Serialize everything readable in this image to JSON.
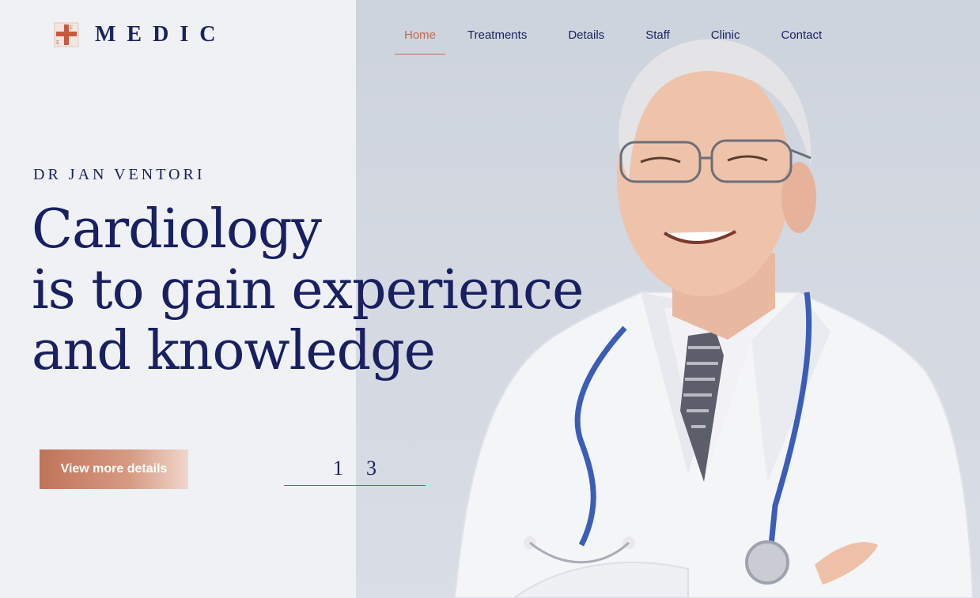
{
  "brand": {
    "name": "MEDIC",
    "logo_letters": "E",
    "accent": "#c26a4e",
    "primary": "#1a2360"
  },
  "nav": {
    "items": [
      {
        "label": "Home",
        "active": true
      },
      {
        "label": "Treatments",
        "active": false
      },
      {
        "label": "Details",
        "active": false
      },
      {
        "label": "Staff",
        "active": false
      },
      {
        "label": "Clinic",
        "active": false
      },
      {
        "label": "Contact",
        "active": false
      }
    ]
  },
  "hero": {
    "subtitle": "DR JAN VENTORI",
    "headline_lines": [
      "Cardiology",
      "is to gain experience",
      "and knowledge"
    ],
    "cta_label": "View more details",
    "pager": {
      "current": "1",
      "total": "3"
    },
    "photo_subject": "smiling senior doctor in white coat with stethoscope"
  }
}
